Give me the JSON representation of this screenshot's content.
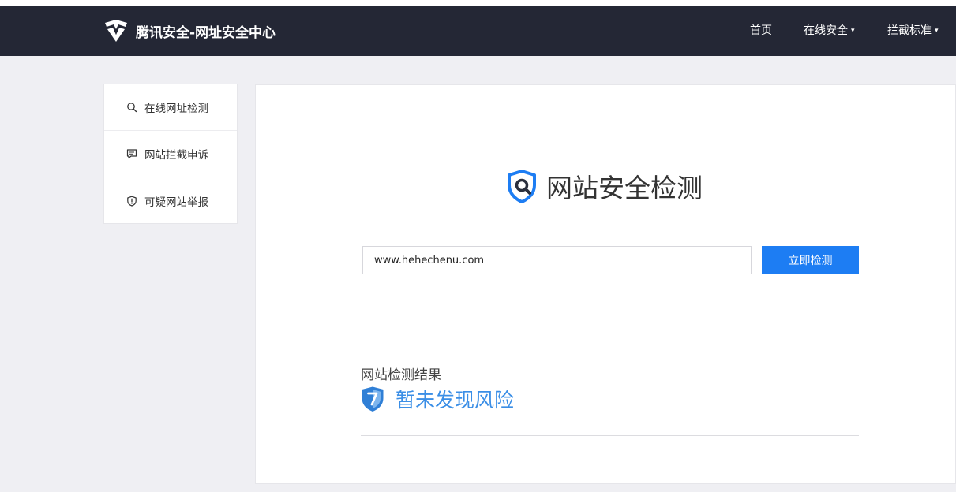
{
  "header": {
    "brand_title": "腾讯安全-网址安全中心",
    "nav": [
      {
        "label": "首页",
        "has_caret": false
      },
      {
        "label": "在线安全",
        "has_caret": true
      },
      {
        "label": "拦截标准",
        "has_caret": true
      }
    ],
    "caret_glyph": "▾"
  },
  "sidebar": {
    "items": [
      {
        "label": "在线网址检测",
        "icon": "search-icon"
      },
      {
        "label": "网站拦截申诉",
        "icon": "chat-icon"
      },
      {
        "label": "可疑网站举报",
        "icon": "shield-alert-icon"
      }
    ]
  },
  "main": {
    "hero_title": "网站安全检测",
    "url_input_value": "www.hehechenu.com",
    "check_button_label": "立即检测",
    "result_label": "网站检测结果",
    "result_status": "暂未发现风险",
    "icons": {
      "hero": "shield-search-icon",
      "result": "shield-check-icon"
    }
  },
  "colors": {
    "navbar_bg": "#242735",
    "accent_blue": "#1d7df3",
    "result_blue": "#3a8ee6",
    "page_bg": "#efeff3"
  }
}
